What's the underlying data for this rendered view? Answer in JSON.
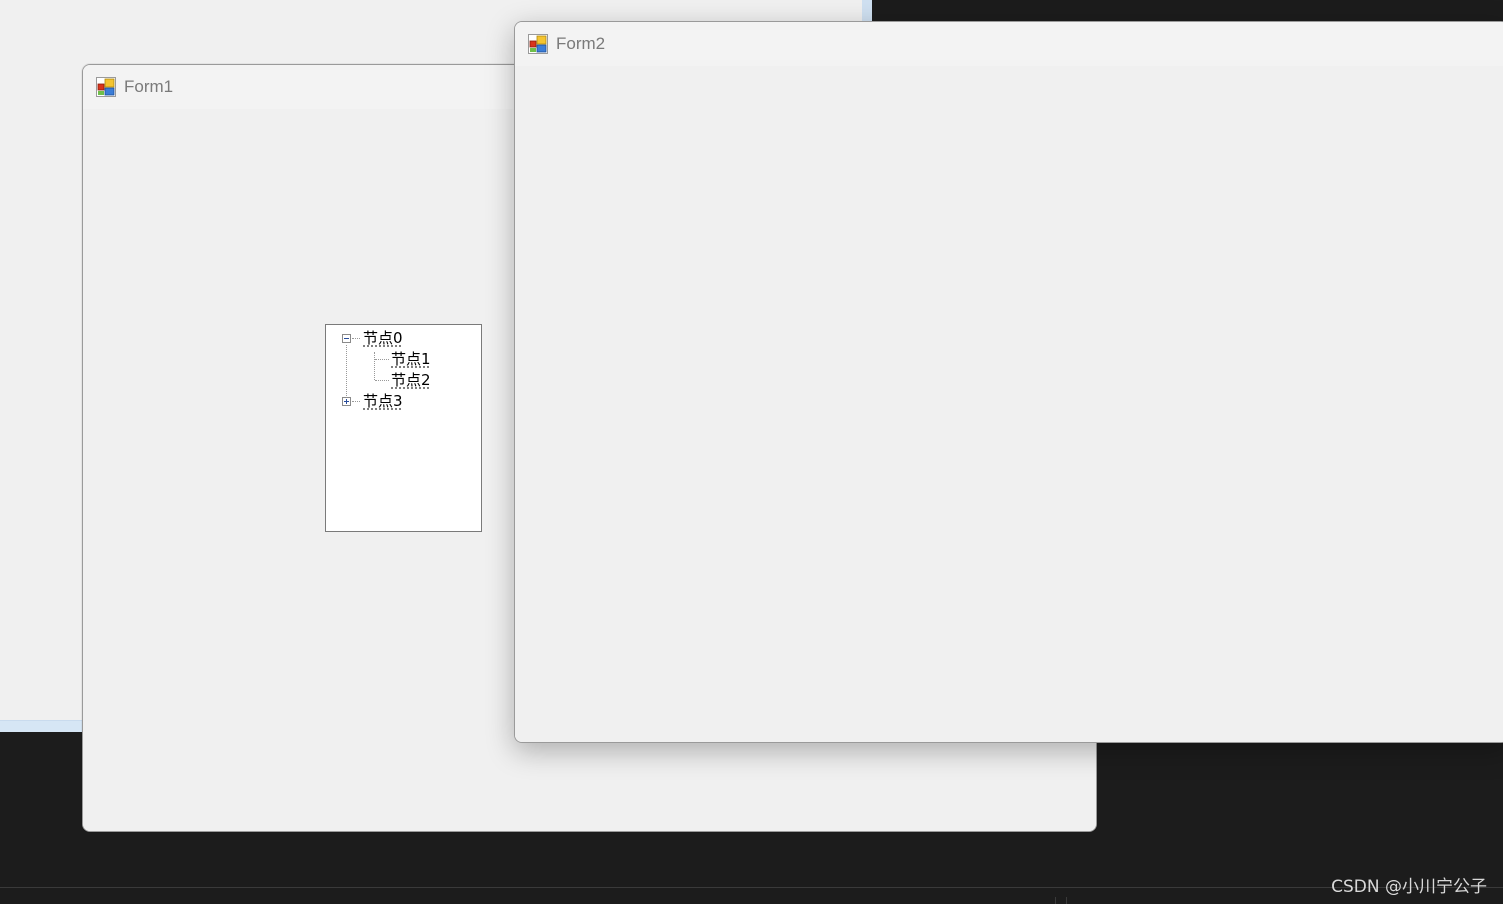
{
  "form1": {
    "title": "Form1",
    "treeview": {
      "nodes": [
        {
          "label": "节点0",
          "expanded": true,
          "children": [
            {
              "label": "节点1"
            },
            {
              "label": "节点2"
            }
          ]
        },
        {
          "label": "节点3",
          "expanded": false
        }
      ]
    }
  },
  "form2": {
    "title": "Form2"
  },
  "watermark": "CSDN @小川宁公子",
  "colors": {
    "window_bg": "#f0f0f0",
    "desktop_dark": "#1c1c1c",
    "expander_accent": "#2a4d9b"
  },
  "icons": {
    "window_icon": "winforms-app-icon",
    "collapse": "minus-box-icon",
    "expand": "plus-box-icon"
  }
}
